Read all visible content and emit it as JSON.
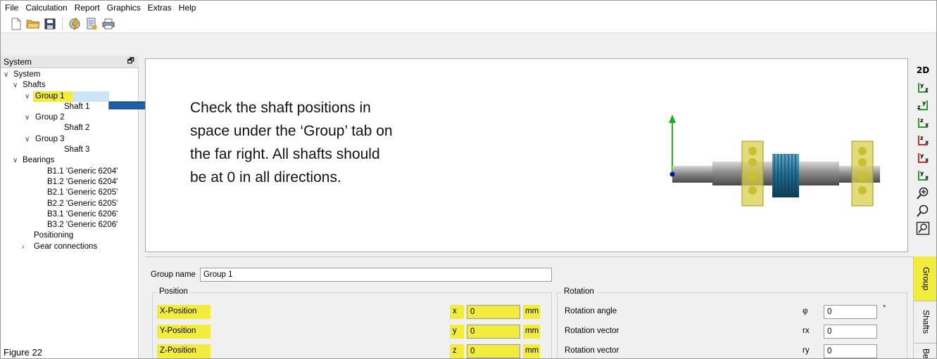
{
  "menubar": {
    "items": [
      "File",
      "Calculation",
      "Report",
      "Graphics",
      "Extras",
      "Help"
    ]
  },
  "toolbar": {
    "icons": [
      "new-file-icon",
      "open-folder-icon",
      "save-icon",
      "calculate-icon",
      "report-icon",
      "print-icon"
    ]
  },
  "left_panel": {
    "title": "System",
    "tree": {
      "system": "System",
      "shafts": "Shafts",
      "group1": "Group 1",
      "shaft1": "Shaft 1",
      "group2": "Group 2",
      "shaft2": "Shaft 2",
      "group3": "Group 3",
      "shaft3": "Shaft 3",
      "bearings": "Bearings",
      "b11": "B1.1 'Generic 6204'",
      "b12": "B1.2 'Generic 6204'",
      "b21": "B2.1 'Generic 6205'",
      "b22": "B2.2 'Generic 6205'",
      "b31": "B3.1 'Generic 6206'",
      "b32": "B3.2 'Generic 6206'",
      "positioning": "Positioning",
      "gear_connections": "Gear connections"
    }
  },
  "figure_label": "Figure 22",
  "annotation": {
    "line1": "Check the shaft positions in",
    "line2": "space under the ‘Group’ tab on",
    "line3": "the far right. All shafts should",
    "line4": "be at 0 in all directions."
  },
  "view_tools": {
    "label_2d": "2D"
  },
  "properties": {
    "group_name_label": "Group name",
    "group_name_value": "Group 1",
    "position": {
      "title": "Position",
      "rows": [
        {
          "label": "X-Position",
          "axis": "x",
          "value": "0",
          "unit": "mm"
        },
        {
          "label": "Y-Position",
          "axis": "y",
          "value": "0",
          "unit": "mm"
        },
        {
          "label": "Z-Position",
          "axis": "z",
          "value": "0",
          "unit": "mm"
        }
      ]
    },
    "rotation": {
      "title": "Rotation",
      "rows": [
        {
          "label": "Rotation angle",
          "symbol": "φ",
          "value": "0",
          "unit": "°"
        },
        {
          "label": "Rotation vector",
          "symbol": "rx",
          "value": "0",
          "unit": ""
        },
        {
          "label": "Rotation vector",
          "symbol": "ry",
          "value": "0",
          "unit": ""
        }
      ]
    }
  },
  "side_tabs": {
    "group": "Group",
    "shafts": "Shafts",
    "bearings": "Be"
  },
  "colors": {
    "highlight": "#f2ec3d",
    "arrow": "#1f5fa8",
    "gear": "#1e6b8e",
    "bearing": "#d7d04a"
  }
}
